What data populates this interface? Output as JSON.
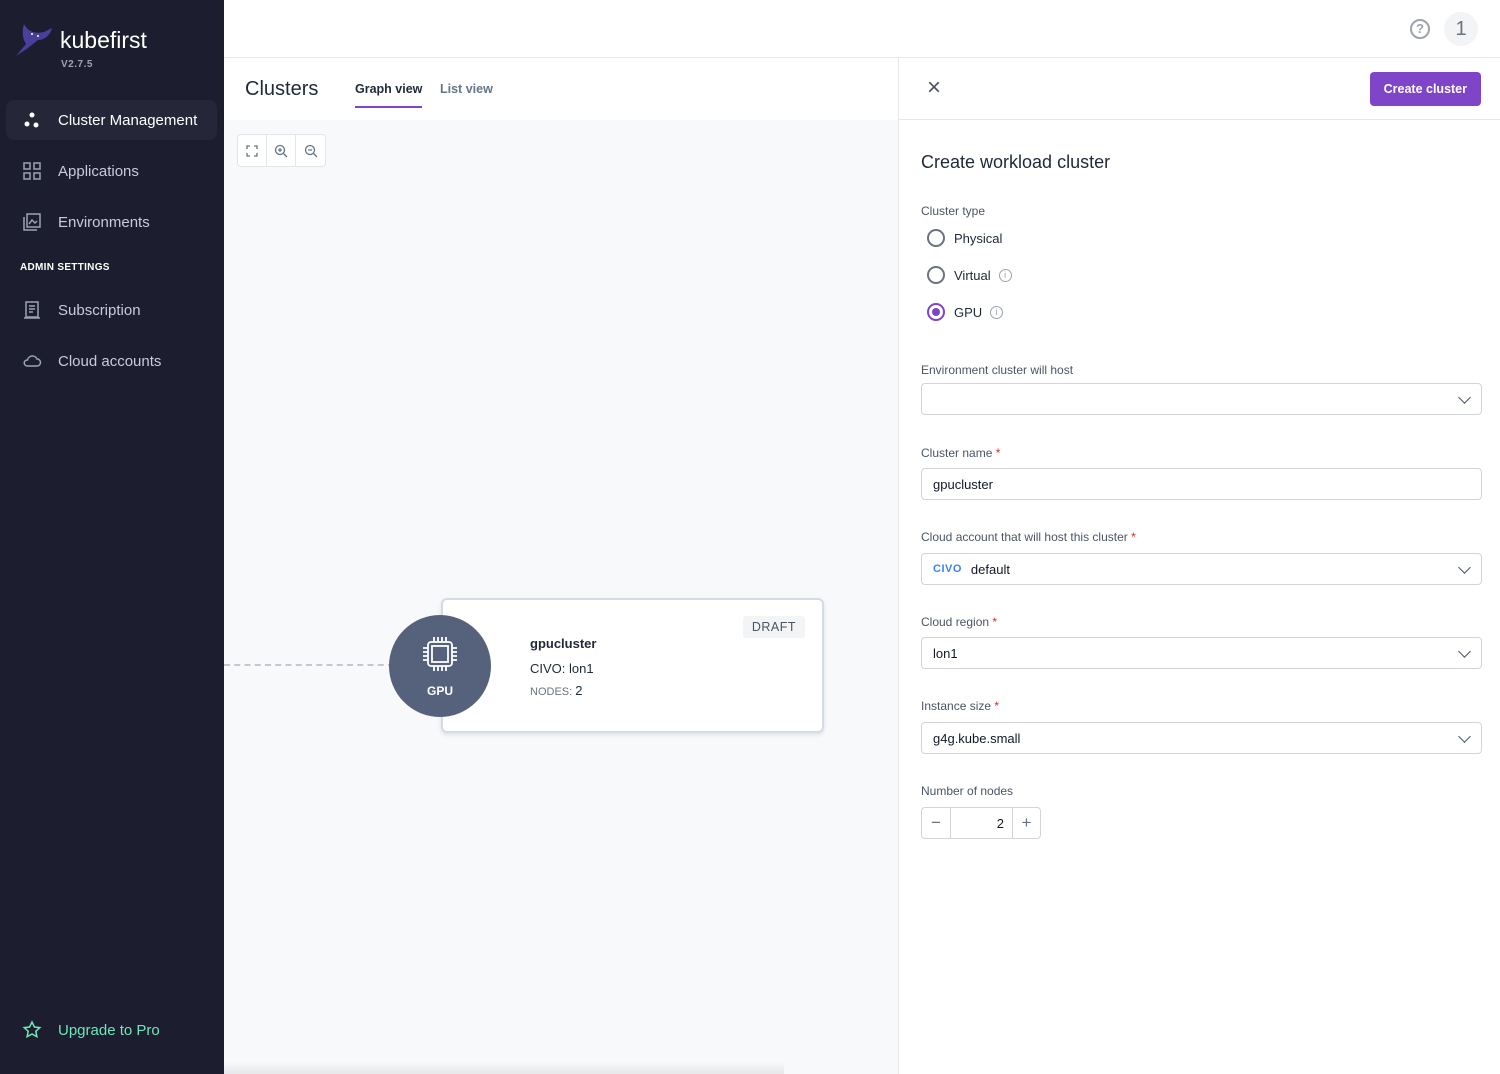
{
  "app": {
    "name": "kubefirst",
    "version": "V2.7.5"
  },
  "sidebar": {
    "items": [
      {
        "label": "Cluster Management",
        "icon": "cluster-icon"
      },
      {
        "label": "Applications",
        "icon": "grid-icon"
      },
      {
        "label": "Environments",
        "icon": "environments-icon"
      }
    ],
    "admin_heading": "ADMIN SETTINGS",
    "admin_items": [
      {
        "label": "Subscription",
        "icon": "receipt-icon"
      },
      {
        "label": "Cloud accounts",
        "icon": "cloud-icon"
      }
    ],
    "upgrade": "Upgrade to Pro"
  },
  "topbar": {
    "help": "?",
    "avatar": "1"
  },
  "header": {
    "title": "Clusters",
    "tabs": [
      {
        "label": "Graph view",
        "active": true
      },
      {
        "label": "List view",
        "active": false
      }
    ]
  },
  "graph": {
    "node": {
      "type": "GPU",
      "name": "gpucluster",
      "provider": "CIVO: lon1",
      "nodes_label": "NODES:",
      "nodes": "2",
      "status": "DRAFT"
    }
  },
  "panel": {
    "close": "×",
    "create_button": "Create cluster",
    "title": "Create workload cluster",
    "cluster_type_label": "Cluster type",
    "cluster_types": [
      {
        "label": "Physical",
        "selected": false
      },
      {
        "label": "Virtual",
        "selected": false
      },
      {
        "label": "GPU",
        "selected": true
      }
    ],
    "environment_label": "Environment cluster will host",
    "environment_value": "",
    "name_label": "Cluster name",
    "name_value": "gpucluster",
    "account_label": "Cloud account that will host this cluster",
    "account_logo": "CIVO",
    "account_value": "default",
    "region_label": "Cloud region",
    "region_value": "lon1",
    "size_label": "Instance size",
    "size_value": "g4g.kube.small",
    "nodes_label": "Number of nodes",
    "nodes_value": "2",
    "minus": "−",
    "plus": "+",
    "required": "*"
  },
  "colors": {
    "accent": "#7e45c9",
    "sidebar": "#1c1d2e",
    "upgrade": "#6ee7b7"
  }
}
